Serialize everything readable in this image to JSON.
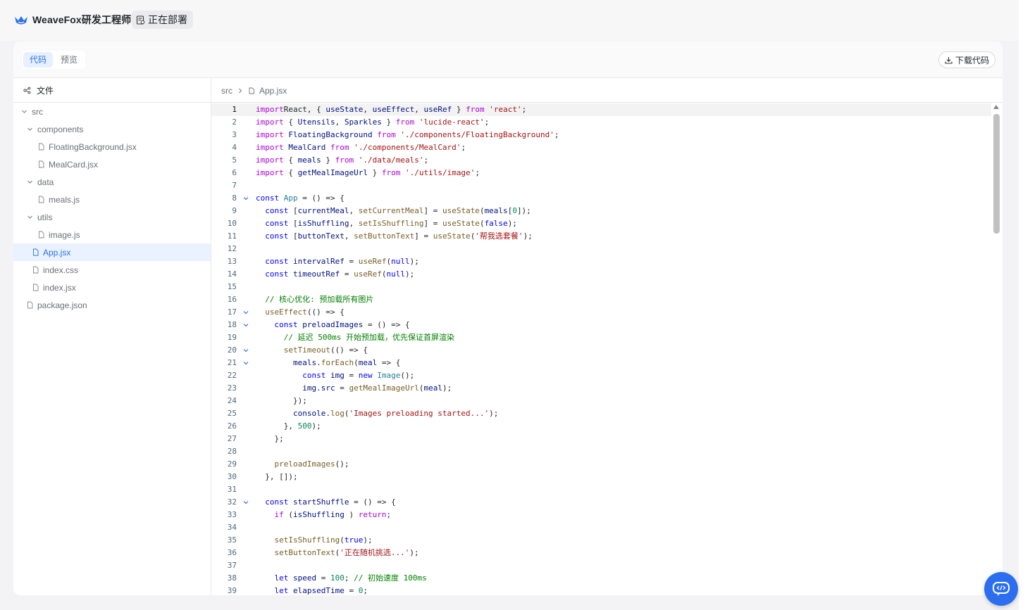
{
  "app": {
    "brand_name": "WeaveFox研发工程师",
    "status_label": "正在部署",
    "accent_color": "#2b73e6",
    "brand_icon": "fox-logo-icon",
    "status_icon": "deploy-doc-icon"
  },
  "toolbar": {
    "tabs": [
      {
        "label": "代码",
        "active": true
      },
      {
        "label": "预览",
        "active": false
      }
    ],
    "download_label": "下载代码",
    "download_icon": "download-icon"
  },
  "sidebar": {
    "header_label": "文件",
    "header_icon": "file-tree-icon",
    "tree": [
      {
        "label": "src",
        "type": "folder",
        "depth": 0,
        "expanded": true
      },
      {
        "label": "components",
        "type": "folder",
        "depth": 1,
        "expanded": true
      },
      {
        "label": "FloatingBackground.jsx",
        "type": "file",
        "depth": 2
      },
      {
        "label": "MealCard.jsx",
        "type": "file",
        "depth": 2
      },
      {
        "label": "data",
        "type": "folder",
        "depth": 1,
        "expanded": true
      },
      {
        "label": "meals.js",
        "type": "file",
        "depth": 2
      },
      {
        "label": "utils",
        "type": "folder",
        "depth": 1,
        "expanded": true
      },
      {
        "label": "image.js",
        "type": "file",
        "depth": 2
      },
      {
        "label": "App.jsx",
        "type": "file",
        "depth": 1,
        "selected": true
      },
      {
        "label": "index.css",
        "type": "file",
        "depth": 1
      },
      {
        "label": "index.jsx",
        "type": "file",
        "depth": 1
      },
      {
        "label": "package.json",
        "type": "file",
        "depth": 0
      }
    ]
  },
  "editor": {
    "breadcrumb": [
      "src",
      "App.jsx"
    ],
    "current_line": 1,
    "lines": [
      {
        "n": "1",
        "fold": false
      },
      {
        "n": "2",
        "fold": false
      },
      {
        "n": "3",
        "fold": false
      },
      {
        "n": "4",
        "fold": false
      },
      {
        "n": "5",
        "fold": false
      },
      {
        "n": "6",
        "fold": false
      },
      {
        "n": "7",
        "fold": false
      },
      {
        "n": "8",
        "fold": true
      },
      {
        "n": "9",
        "fold": false
      },
      {
        "n": "10",
        "fold": false
      },
      {
        "n": "11",
        "fold": false
      },
      {
        "n": "12",
        "fold": false
      },
      {
        "n": "13",
        "fold": false
      },
      {
        "n": "14",
        "fold": false
      },
      {
        "n": "15",
        "fold": false
      },
      {
        "n": "16",
        "fold": false
      },
      {
        "n": "17",
        "fold": true
      },
      {
        "n": "18",
        "fold": true
      },
      {
        "n": "19",
        "fold": false
      },
      {
        "n": "20",
        "fold": true
      },
      {
        "n": "21",
        "fold": true
      },
      {
        "n": "22",
        "fold": false
      },
      {
        "n": "23",
        "fold": false
      },
      {
        "n": "24",
        "fold": false
      },
      {
        "n": "25",
        "fold": false
      },
      {
        "n": "26",
        "fold": false
      },
      {
        "n": "27",
        "fold": false
      },
      {
        "n": "28",
        "fold": false
      },
      {
        "n": "29",
        "fold": false
      },
      {
        "n": "30",
        "fold": false
      },
      {
        "n": "31",
        "fold": false
      },
      {
        "n": "32",
        "fold": true
      },
      {
        "n": "33",
        "fold": false
      },
      {
        "n": "34",
        "fold": false
      },
      {
        "n": "35",
        "fold": false
      },
      {
        "n": "36",
        "fold": false
      },
      {
        "n": "37",
        "fold": false
      },
      {
        "n": "38",
        "fold": false
      },
      {
        "n": "39",
        "fold": false
      }
    ],
    "code": [
      [
        [
          "k2",
          "import"
        ],
        [
          "",
          "React, { "
        ],
        [
          "v",
          "useState"
        ],
        [
          "",
          ", "
        ],
        [
          "v",
          "useEffect"
        ],
        [
          "",
          ", "
        ],
        [
          "v",
          "useRef"
        ],
        [
          "",
          " } "
        ],
        [
          "k2",
          "from"
        ],
        [
          "",
          ""
        ],
        [
          "s",
          " 'react'"
        ],
        [
          "",
          ";"
        ]
      ],
      [
        [
          "k2",
          "import"
        ],
        [
          "",
          " { "
        ],
        [
          "v",
          "Utensils"
        ],
        [
          "",
          ", "
        ],
        [
          "v",
          "Sparkles"
        ],
        [
          "",
          " } "
        ],
        [
          "k2",
          "from"
        ],
        [
          "s",
          " 'lucide-react'"
        ],
        [
          "",
          ";"
        ]
      ],
      [
        [
          "k2",
          "import"
        ],
        [
          "v",
          " FloatingBackground"
        ],
        [
          "k2",
          " from"
        ],
        [
          "s",
          " './components/FloatingBackground'"
        ],
        [
          "",
          ";"
        ]
      ],
      [
        [
          "k2",
          "import"
        ],
        [
          "v",
          " MealCard"
        ],
        [
          "k2",
          " from"
        ],
        [
          "s",
          " './components/MealCard'"
        ],
        [
          "",
          ";"
        ]
      ],
      [
        [
          "k2",
          "import"
        ],
        [
          "",
          " { "
        ],
        [
          "v",
          "meals"
        ],
        [
          "",
          " } "
        ],
        [
          "k2",
          "from"
        ],
        [
          "s",
          " './data/meals'"
        ],
        [
          "",
          ";"
        ]
      ],
      [
        [
          "k2",
          "import"
        ],
        [
          "",
          " { "
        ],
        [
          "v",
          "getMealImageUrl"
        ],
        [
          "",
          " } "
        ],
        [
          "k2",
          "from"
        ],
        [
          "s",
          " './utils/image'"
        ],
        [
          "",
          ";"
        ]
      ],
      [],
      [
        [
          "k",
          "const"
        ],
        [
          "t",
          " App"
        ],
        [
          "",
          " = () => {"
        ]
      ],
      [
        [
          "",
          "  "
        ],
        [
          "k",
          "const"
        ],
        [
          "",
          " ["
        ],
        [
          "v",
          "currentMeal"
        ],
        [
          "",
          ", "
        ],
        [
          "f",
          "setCurrentMeal"
        ],
        [
          "",
          "] = "
        ],
        [
          "f",
          "useState"
        ],
        [
          "",
          "("
        ],
        [
          "v",
          "meals"
        ],
        [
          "",
          "["
        ],
        [
          "n",
          "0"
        ],
        [
          "",
          "]);"
        ]
      ],
      [
        [
          "",
          "  "
        ],
        [
          "k",
          "const"
        ],
        [
          "",
          " ["
        ],
        [
          "v",
          "isShuffling"
        ],
        [
          "",
          ", "
        ],
        [
          "f",
          "setIsShuffling"
        ],
        [
          "",
          "] = "
        ],
        [
          "f",
          "useState"
        ],
        [
          "",
          "("
        ],
        [
          "k",
          "false"
        ],
        [
          "",
          ");"
        ]
      ],
      [
        [
          "",
          "  "
        ],
        [
          "k",
          "const"
        ],
        [
          "",
          " ["
        ],
        [
          "v",
          "buttonText"
        ],
        [
          "",
          ", "
        ],
        [
          "f",
          "setButtonText"
        ],
        [
          "",
          "] = "
        ],
        [
          "f",
          "useState"
        ],
        [
          "",
          "("
        ],
        [
          "s",
          "'帮我选套餐'"
        ],
        [
          "",
          ");"
        ]
      ],
      [],
      [
        [
          "",
          "  "
        ],
        [
          "k",
          "const"
        ],
        [
          "v",
          " intervalRef"
        ],
        [
          "",
          " = "
        ],
        [
          "f",
          "useRef"
        ],
        [
          "",
          "("
        ],
        [
          "k",
          "null"
        ],
        [
          "",
          ");"
        ]
      ],
      [
        [
          "",
          "  "
        ],
        [
          "k",
          "const"
        ],
        [
          "v",
          " timeoutRef"
        ],
        [
          "",
          " = "
        ],
        [
          "f",
          "useRef"
        ],
        [
          "",
          "("
        ],
        [
          "k",
          "null"
        ],
        [
          "",
          ");"
        ]
      ],
      [],
      [
        [
          "",
          "  "
        ],
        [
          "c",
          "// 核心优化: 预加载所有图片"
        ]
      ],
      [
        [
          "",
          "  "
        ],
        [
          "f",
          "useEffect"
        ],
        [
          "",
          "(() => {"
        ]
      ],
      [
        [
          "",
          "    "
        ],
        [
          "k",
          "const"
        ],
        [
          "v",
          " preloadImages"
        ],
        [
          "",
          " = () => {"
        ]
      ],
      [
        [
          "",
          "      "
        ],
        [
          "c",
          "// 延迟 500ms 开始预加载，优先保证首屏渲染"
        ]
      ],
      [
        [
          "",
          "      "
        ],
        [
          "f",
          "setTimeout"
        ],
        [
          "",
          "(() => {"
        ]
      ],
      [
        [
          "",
          "        "
        ],
        [
          "v",
          "meals"
        ],
        [
          "",
          "."
        ],
        [
          "f",
          "forEach"
        ],
        [
          "",
          "("
        ],
        [
          "v",
          "meal"
        ],
        [
          "",
          " => {"
        ]
      ],
      [
        [
          "",
          "          "
        ],
        [
          "k",
          "const"
        ],
        [
          "v",
          " img"
        ],
        [
          "",
          " = "
        ],
        [
          "k",
          "new"
        ],
        [
          "t",
          " Image"
        ],
        [
          "",
          "();"
        ]
      ],
      [
        [
          "",
          "          "
        ],
        [
          "v",
          "img"
        ],
        [
          "",
          "."
        ],
        [
          "v",
          "src"
        ],
        [
          "",
          " = "
        ],
        [
          "f",
          "getMealImageUrl"
        ],
        [
          "",
          "("
        ],
        [
          "v",
          "meal"
        ],
        [
          "",
          ");"
        ]
      ],
      [
        [
          "",
          "        });"
        ]
      ],
      [
        [
          "",
          "        "
        ],
        [
          "v",
          "console"
        ],
        [
          "",
          "."
        ],
        [
          "f",
          "log"
        ],
        [
          "",
          "("
        ],
        [
          "s",
          "'Images preloading started...'"
        ],
        [
          "",
          ");"
        ]
      ],
      [
        [
          "",
          "      }, "
        ],
        [
          "n",
          "500"
        ],
        [
          "",
          ");"
        ]
      ],
      [
        [
          "",
          "    };"
        ]
      ],
      [],
      [
        [
          "",
          "    "
        ],
        [
          "f",
          "preloadImages"
        ],
        [
          "",
          "();"
        ]
      ],
      [
        [
          "",
          "  }, []);"
        ]
      ],
      [],
      [
        [
          "",
          "  "
        ],
        [
          "k",
          "const"
        ],
        [
          "v",
          " startShuffle"
        ],
        [
          "",
          " = () => {"
        ]
      ],
      [
        [
          "",
          "    "
        ],
        [
          "k2",
          "if"
        ],
        [
          "",
          " ("
        ],
        [
          "v",
          "isShuffling"
        ],
        [
          "",
          " ) "
        ],
        [
          "k2",
          "return"
        ],
        [
          "",
          ";"
        ]
      ],
      [],
      [
        [
          "",
          "    "
        ],
        [
          "f",
          "setIsShuffling"
        ],
        [
          "",
          "("
        ],
        [
          "k",
          "true"
        ],
        [
          "",
          ");"
        ]
      ],
      [
        [
          "",
          "    "
        ],
        [
          "f",
          "setButtonText"
        ],
        [
          "",
          "("
        ],
        [
          "s",
          "'正在随机挑选...'"
        ],
        [
          "",
          ");"
        ]
      ],
      [],
      [
        [
          "",
          "    "
        ],
        [
          "k",
          "let"
        ],
        [
          "v",
          " speed"
        ],
        [
          "",
          " = "
        ],
        [
          "n",
          "100"
        ],
        [
          "",
          "; "
        ],
        [
          "c",
          "// 初始速度 100ms"
        ]
      ],
      [
        [
          "",
          "    "
        ],
        [
          "k",
          "let"
        ],
        [
          "v",
          " elapsedTime"
        ],
        [
          "",
          " = "
        ],
        [
          "n",
          "0"
        ],
        [
          "",
          ";"
        ]
      ]
    ]
  }
}
